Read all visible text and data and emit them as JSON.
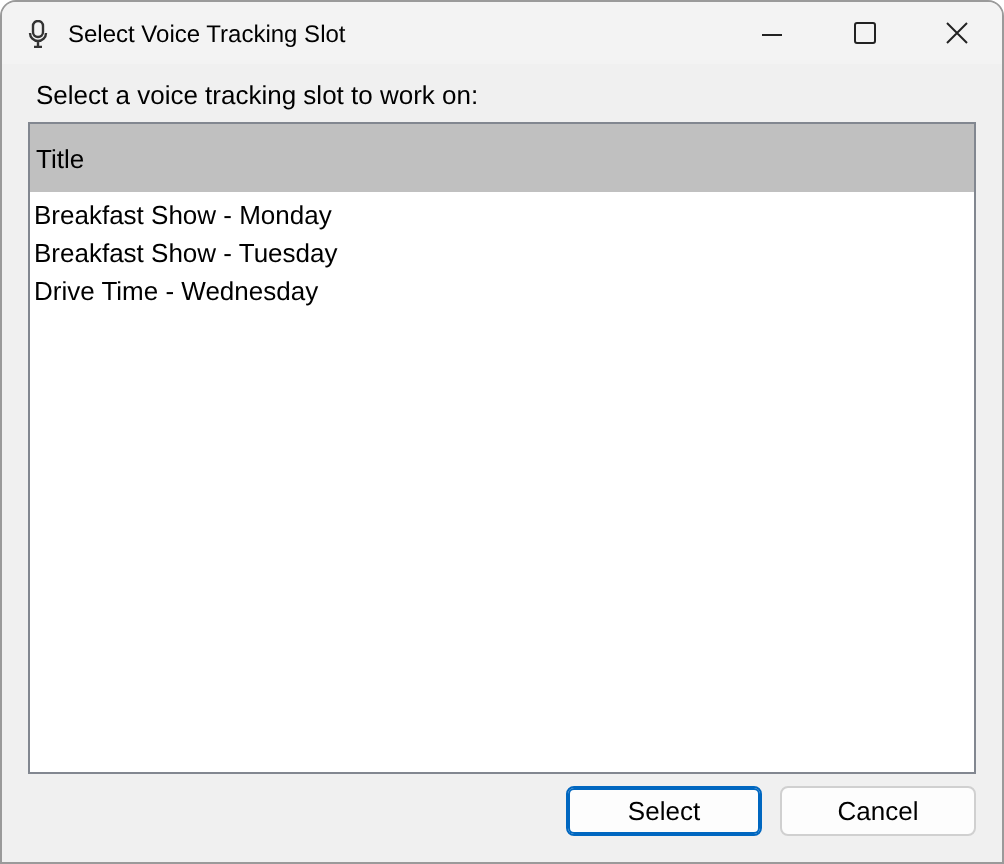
{
  "window": {
    "title": "Select Voice Tracking Slot"
  },
  "prompt": "Select a voice tracking slot to work on:",
  "list": {
    "columns": [
      "Title"
    ],
    "rows": [
      {
        "title": "Breakfast Show - Monday",
        "selected": false
      },
      {
        "title": "Breakfast Show - Tuesday",
        "selected": false
      },
      {
        "title": "Drive Time - Wednesday",
        "selected": false
      }
    ]
  },
  "buttons": [
    {
      "label": "Select",
      "default": true
    },
    {
      "label": "Cancel",
      "default": false
    }
  ]
}
